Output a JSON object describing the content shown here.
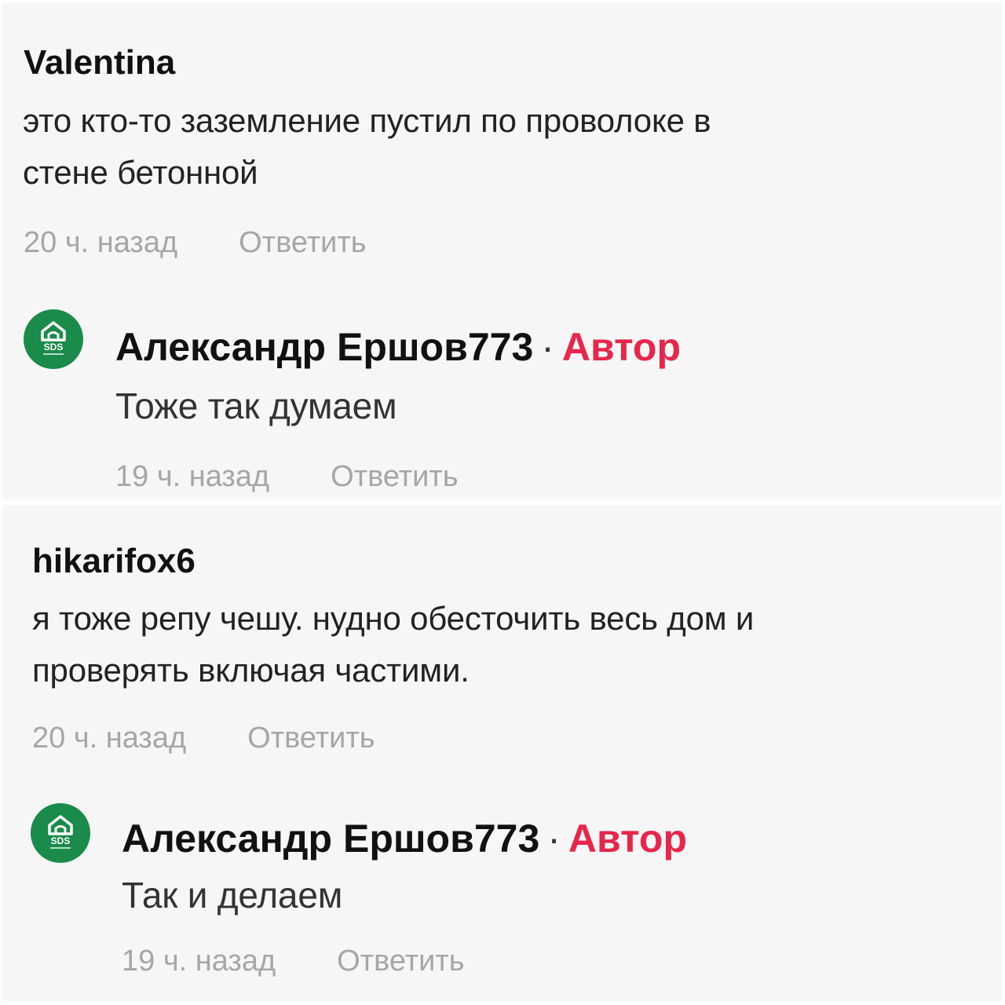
{
  "colors": {
    "author_badge": "#e8264b",
    "avatar_bg": "#1a8b4a",
    "meta_text": "#a6a6a6"
  },
  "comments": [
    {
      "username": "Valentina",
      "text_line1": "это кто-то заземление пустил по проволоке в",
      "text_line2": "стене бетонной",
      "time": "20 ч. назад",
      "reply_label": "Ответить",
      "reply": {
        "avatar_icon": "sds-logo-icon",
        "avatar_text": "SDS",
        "author": "Александр Ершов773",
        "separator": "·",
        "badge": "Автор",
        "text": "Тоже так думаем",
        "time": "19 ч. назад",
        "reply_label": "Ответить"
      }
    },
    {
      "username": "hikarifox6",
      "text_line1": "я тоже репу чешу. нудно обесточить весь дом и",
      "text_line2": "проверять включая частими.",
      "time": "20 ч. назад",
      "reply_label": "Ответить",
      "reply": {
        "avatar_icon": "sds-logo-icon",
        "avatar_text": "SDS",
        "author": "Александр Ершов773",
        "separator": "·",
        "badge": "Автор",
        "text": "Так и делаем",
        "time": "19 ч. назад",
        "reply_label": "Ответить"
      }
    }
  ]
}
